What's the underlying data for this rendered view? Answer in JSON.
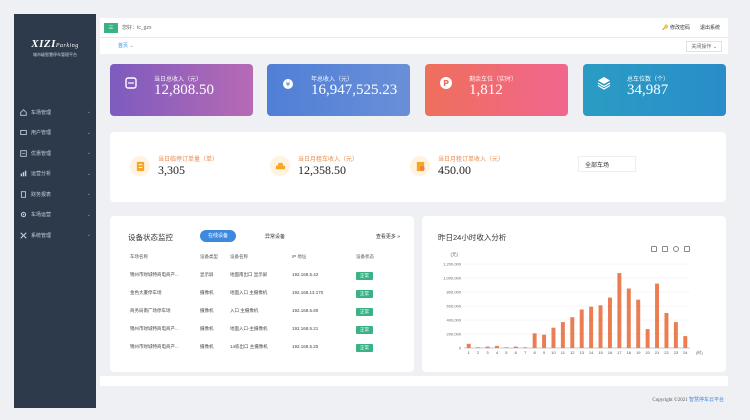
{
  "sidebar": {
    "logo_main": "XIZI",
    "logo_script": "Parking",
    "logo_sub": "城市级智慧停车管理平台",
    "items": [
      {
        "label": "车场管理",
        "icon": "parking-icon"
      },
      {
        "label": "用户管理",
        "icon": "user-icon"
      },
      {
        "label": "优惠管理",
        "icon": "discount-icon"
      },
      {
        "label": "运营分析",
        "icon": "chart-icon"
      },
      {
        "label": "财务报表",
        "icon": "report-icon"
      },
      {
        "label": "车场运营",
        "icon": "gear-icon"
      },
      {
        "label": "系统管理",
        "icon": "tools-icon"
      }
    ]
  },
  "topbar": {
    "menu_label": "三",
    "greeting": "您好：tc_gzx",
    "change_password": "修改密码",
    "logout": "退出系统"
  },
  "tabbar": {
    "home": "首页",
    "close_ops": "关闭操作"
  },
  "stats": [
    {
      "label": "当日总收入（元）",
      "value": "12,808.50",
      "color_from": "#7d5bbf",
      "color_to": "#b76ab5",
      "icon": "income-icon"
    },
    {
      "label": "年总收入（元）",
      "value": "16,947,525.23",
      "color_from": "#4f7fd6",
      "color_to": "#6a8fd8",
      "icon": "money-bag-icon"
    },
    {
      "label": "剩余车位（实时）",
      "value": "1,812",
      "color_from": "#ef6f5c",
      "color_to": "#f0668e",
      "icon": "parking-circle-icon"
    },
    {
      "label": "总车位数（个）",
      "value": "34,987",
      "color_from": "#2a9dc4",
      "color_to": "#2a8cc9",
      "icon": "layers-icon"
    }
  ],
  "summary": {
    "items": [
      {
        "label": "当日临停订单量（单）",
        "value": "3,305",
        "icon": "order-icon"
      },
      {
        "label": "当日月租车收入（元）",
        "value": "12,358.50",
        "icon": "car-coin-icon"
      },
      {
        "label": "当日月租订单收入（元）",
        "value": "450.00",
        "icon": "receipt-icon"
      }
    ],
    "lot_select": "全部车场"
  },
  "device_panel": {
    "title": "设备状态监控",
    "tab_online": "在线设备",
    "tab_offline": "异常设备",
    "view_more": "查看更多 »",
    "columns": [
      "车场名称",
      "设备类型",
      "设备名称",
      "IP 地址",
      "设备状态"
    ],
    "rows": [
      [
        "锦州市财城特商电商产...",
        "显示屏",
        "地面南出口 显示屏",
        "192.168.5.42",
        "正常"
      ],
      [
        "金色大厦停车场",
        "摄像机",
        "地面入口 主摄像机",
        "192.168.13.170",
        "正常"
      ],
      [
        "商务局南广场停车场",
        "摄像机",
        "入口 主摄像机",
        "192.168.5.80",
        "正常"
      ],
      [
        "锦州市财城特商电商产...",
        "摄像机",
        "地面入口-主摄像机",
        "192.168.5.21",
        "正常"
      ],
      [
        "锦州市财城特商电商产...",
        "摄像机",
        "14栋出口 主摄像机",
        "192.168.5.20",
        "正常"
      ]
    ]
  },
  "chart_panel": {
    "title": "昨日24小时收入分析"
  },
  "chart_data": {
    "type": "bar",
    "ylabel": "(元)",
    "xlabel": "(时)",
    "ylim": [
      0,
      1200000
    ],
    "yticks": [
      "0",
      "200,000",
      "400,000",
      "600,000",
      "800,000",
      "1,000,000",
      "1,200,000"
    ],
    "categories": [
      "1",
      "2",
      "3",
      "4",
      "5",
      "6",
      "7",
      "8",
      "9",
      "10",
      "11",
      "12",
      "13",
      "14",
      "15",
      "16",
      "17",
      "18",
      "19",
      "20",
      "21",
      "22",
      "23",
      "24"
    ],
    "values": [
      60000,
      10000,
      20000,
      30000,
      10000,
      20000,
      10000,
      210000,
      190000,
      290000,
      370000,
      440000,
      550000,
      590000,
      610000,
      720000,
      1070000,
      850000,
      690000,
      270000,
      920000,
      500000,
      370000,
      170000
    ],
    "color": "#ea7d52",
    "grid": true
  },
  "footer": {
    "copyright": "Copyright ©2021",
    "brand": "智慧停车云平台"
  }
}
